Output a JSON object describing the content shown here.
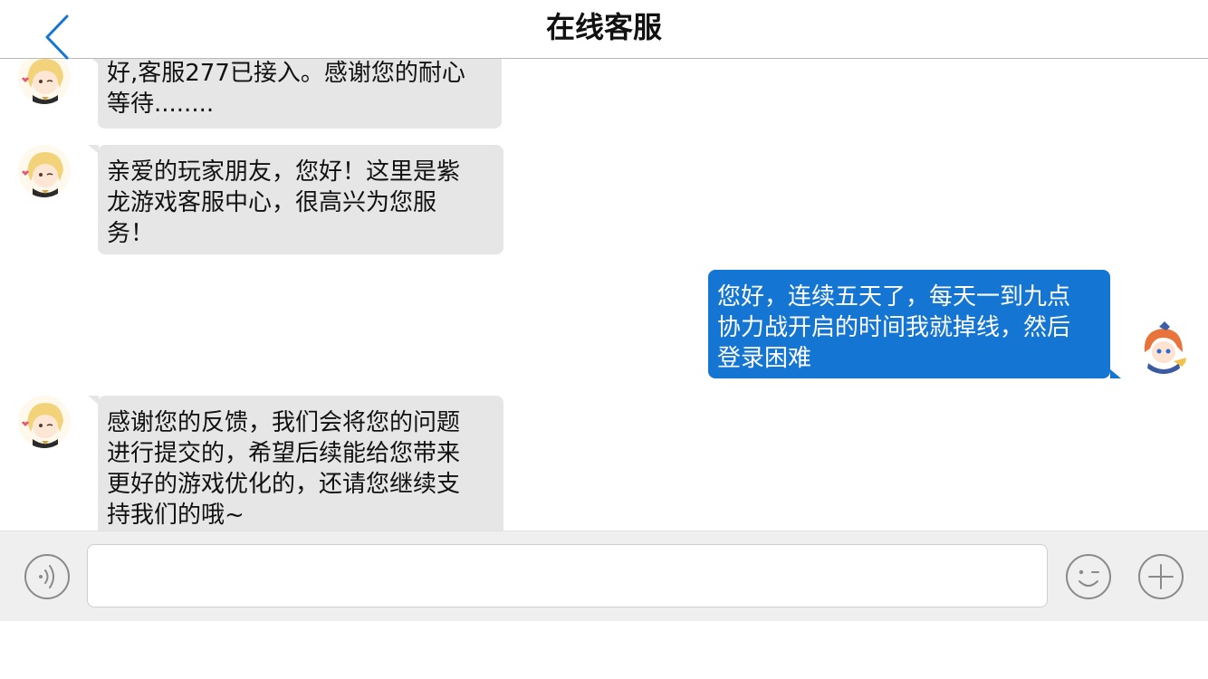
{
  "header": {
    "title": "在线客服"
  },
  "messages": [
    {
      "sender": "agent",
      "lines": "好,客服277已接入。感谢您的耐心\n等待........"
    },
    {
      "sender": "agent",
      "lines": "亲爱的玩家朋友，您好！这里是紫\n龙游戏客服中心，很高兴为您服\n务！"
    },
    {
      "sender": "user",
      "lines": "您好，连续五天了，每天一到九点\n协力战开启的时间我就掉线，然后\n登录困难"
    },
    {
      "sender": "agent",
      "lines": "感谢您的反馈，我们会将您的问题\n进行提交的，希望后续能给您带来\n更好的游戏优化的，还请您继续支\n持我们的哦~"
    }
  ],
  "input": {
    "value": "",
    "placeholder": ""
  },
  "icons": {
    "back": "chevron-left-icon",
    "voice": "voice-icon",
    "emoji": "emoji-icon",
    "plus": "plus-icon"
  },
  "colors": {
    "accent": "#1475d3",
    "incoming_bubble": "#e6e6e6",
    "outgoing_bubble": "#1475d3",
    "input_bar": "#efefef"
  }
}
